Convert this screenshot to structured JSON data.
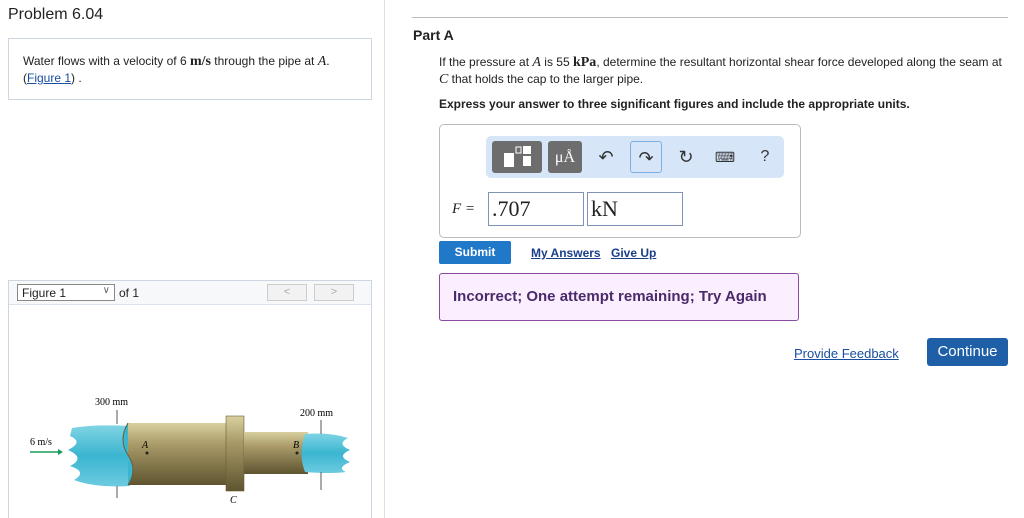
{
  "problem": {
    "title": "Problem 6.04",
    "text_1": "Water flows with a velocity of 6 ",
    "unit": "m/s",
    "text_2": " through the pipe at ",
    "point": "A",
    "text_3": ". (",
    "figure_link": "Figure 1",
    "text_4": ") ."
  },
  "figure": {
    "select_value": "Figure 1",
    "of_label": "of 1",
    "prev": "<",
    "next": ">",
    "labels": {
      "d1": "300 mm",
      "d2": "200 mm",
      "v": "6 m/s",
      "a": "A",
      "b": "B",
      "c": "C"
    }
  },
  "part": {
    "title": "Part A",
    "q1": "If the pressure at ",
    "qA": "A",
    "q2": " is 55 ",
    "qunit": "kPa",
    "q3": ", determine the resultant horizontal shear force developed along the seam at ",
    "qC": "C",
    "q4": " that holds the cap to the larger pipe.",
    "instructions": "Express your answer to three significant figures and include the appropriate units."
  },
  "answer": {
    "label": "F =",
    "value": ".707",
    "units": "kN",
    "units_btn": "μÅ",
    "help": "?"
  },
  "actions": {
    "submit": "Submit",
    "my_answers": "My Answers",
    "give_up": "Give Up"
  },
  "feedback": "Incorrect; One attempt remaining; Try Again",
  "footer": {
    "provide_feedback": "Provide Feedback",
    "continue": "Continue"
  }
}
